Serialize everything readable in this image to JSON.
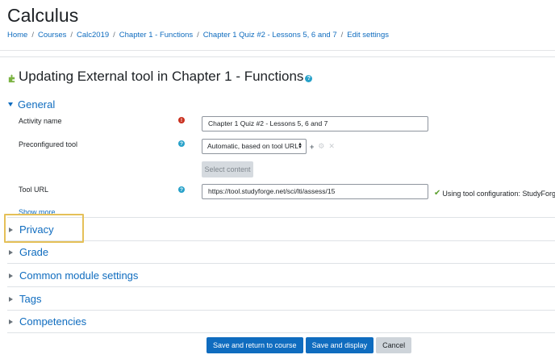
{
  "course": {
    "title": "Calculus"
  },
  "breadcrumb": [
    {
      "label": "Home"
    },
    {
      "label": "Courses"
    },
    {
      "label": "Calc2019"
    },
    {
      "label": "Chapter 1 - Functions"
    },
    {
      "label": "Chapter 1 Quiz #2 - Lessons 5, 6 and 7"
    },
    {
      "label": "Edit settings"
    }
  ],
  "breadcrumb_separator": "/",
  "heading": {
    "text": "Updating External tool in Chapter 1 - Functions",
    "help_symbol": "?"
  },
  "sections": {
    "general": "General",
    "privacy": "Privacy",
    "grade": "Grade",
    "common": "Common module settings",
    "tags": "Tags",
    "competencies": "Competencies"
  },
  "form": {
    "activity_name_label": "Activity name",
    "activity_name_value": "Chapter 1 Quiz #2 - Lessons 5, 6 and 7",
    "required_symbol": "!",
    "preconfigured_label": "Preconfigured tool",
    "preconfigured_value": "Automatic, based on tool URL",
    "info_symbol": "?",
    "select_content_label": "Select content",
    "tool_url_label": "Tool URL",
    "tool_url_value": "https://tool.studyforge.net/sci/lti/assess/15",
    "tool_config_msg": "Using tool configuration: StudyForge",
    "show_more": "Show more..."
  },
  "buttons": {
    "save_return": "Save and return to course",
    "save_display": "Save and display",
    "cancel": "Cancel"
  },
  "colors": {
    "link": "#0f6cbf",
    "primary_button": "#0f6cbf",
    "highlight": "#e5c058",
    "required": "#ca3120",
    "info": "#27a1c9",
    "valid": "#5b9f2e"
  },
  "icons": {
    "module": "puzzle-icon",
    "required": "exclamation-icon",
    "help": "question-icon",
    "add": "plus-icon",
    "edit": "gear-icon",
    "delete": "close-icon",
    "valid": "checkmark-icon"
  }
}
